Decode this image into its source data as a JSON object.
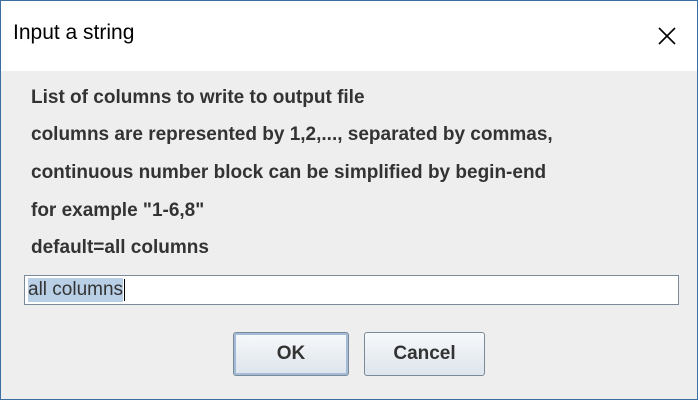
{
  "dialog": {
    "title": "Input a string",
    "close_icon": "close-icon",
    "message_lines": [
      "List of columns to write to output file",
      "columns are represented by 1,2,..., separated by commas,",
      "continuous number block can be simplified by begin-end",
      "for example \"1-6,8\"",
      "default=all columns"
    ],
    "input_value": "all columns",
    "ok_label": "OK",
    "cancel_label": "Cancel"
  },
  "colors": {
    "title_bg": "#ffffff",
    "content_bg": "#eeeeee",
    "border": "#3c6e9e",
    "selection": "#b8cfe5"
  }
}
